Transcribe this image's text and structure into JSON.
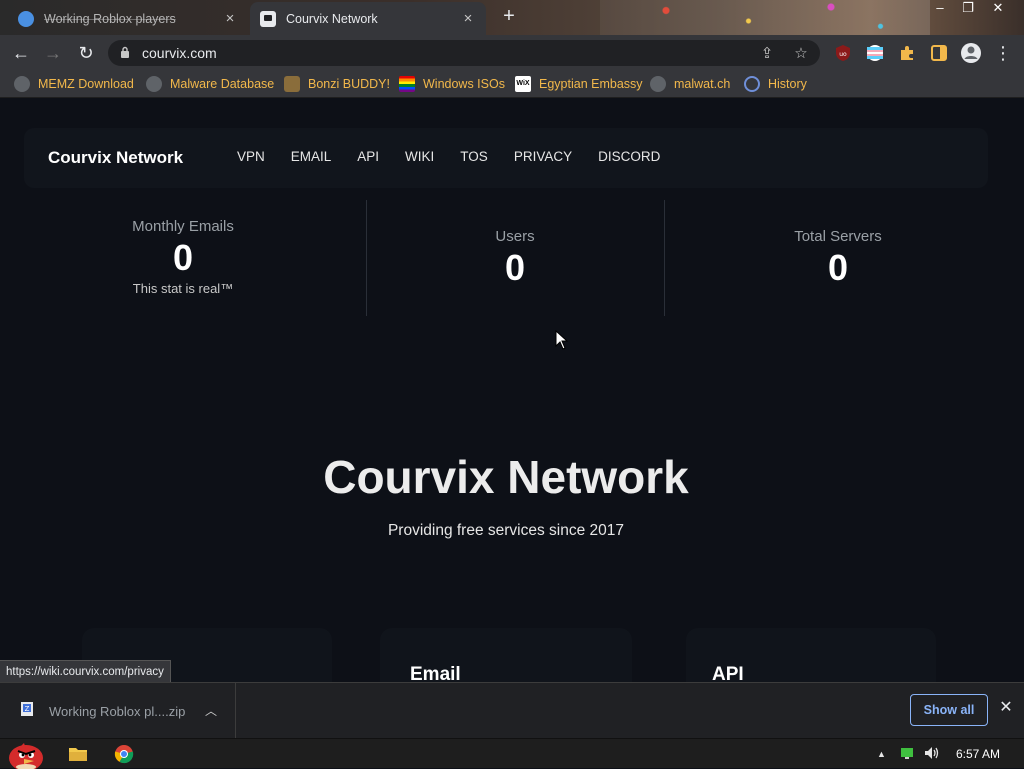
{
  "browser": {
    "tabs": [
      {
        "title": "Working Roblox players",
        "active": false,
        "icon": "blue-circle-favicon"
      },
      {
        "title": "Courvix Network",
        "active": true,
        "icon": "courvix-favicon"
      }
    ],
    "address": "courvix.com",
    "bookmarks": [
      {
        "label": "MEMZ Download",
        "icon": "globe-icon"
      },
      {
        "label": "Malware Database",
        "icon": "globe-icon"
      },
      {
        "label": "Bonzi BUDDY!",
        "icon": "bonzi-icon"
      },
      {
        "label": "Windows ISOs",
        "icon": "rainbow-flag-icon"
      },
      {
        "label": "Egyptian Embassy",
        "icon": "wix-icon"
      },
      {
        "label": "malwat.ch",
        "icon": "globe-icon"
      },
      {
        "label": "History",
        "icon": "history-icon"
      }
    ],
    "status_url": "https://wiki.courvix.com/privacy"
  },
  "site": {
    "brand": "Courvix Network",
    "nav": [
      "VPN",
      "EMAIL",
      "API",
      "WIKI",
      "TOS",
      "PRIVACY",
      "DISCORD"
    ],
    "stats": [
      {
        "label": "Monthly Emails",
        "value": "0",
        "note": "This stat is real™"
      },
      {
        "label": "Users",
        "value": "0",
        "note": ""
      },
      {
        "label": "Total Servers",
        "value": "0",
        "note": ""
      }
    ],
    "hero_title": "Courvix Network",
    "hero_subtitle": "Providing free services since 2017",
    "cards": [
      "",
      "Email",
      "API"
    ]
  },
  "downloads": {
    "file": "Working Roblox pl....zip",
    "show_all": "Show all"
  },
  "taskbar": {
    "time": "6:57 AM"
  },
  "colors": {
    "page_bg": "#0d1017",
    "bookmark_text": "#f2b84b",
    "accent_blue": "#8ab4f8"
  }
}
